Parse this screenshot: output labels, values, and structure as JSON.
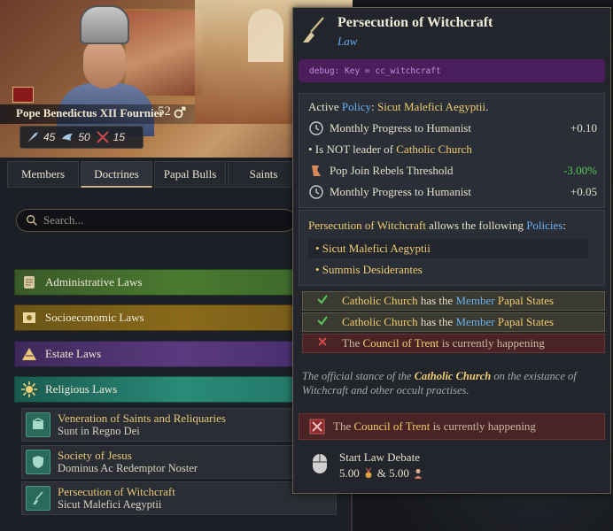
{
  "ruler": {
    "name": "Pope Benedictus XII Fournier",
    "age": "52",
    "stats": [
      "45",
      "50",
      "15"
    ]
  },
  "tabs": [
    "Members",
    "Doctrines",
    "Papal Bulls",
    "Saints"
  ],
  "search": {
    "placeholder": "Search..."
  },
  "categories": [
    "Administrative Laws",
    "Socioeconomic Laws",
    "Estate Laws",
    "Religious Laws"
  ],
  "laws": [
    {
      "title": "Veneration of Saints and Reliquaries",
      "sub": "Sunt in Regno Dei"
    },
    {
      "title": "Society of Jesus",
      "sub": "Dominus Ac Redemptor Noster"
    },
    {
      "title": "Persecution of Witchcraft",
      "sub": "Sicut Malefici Aegyptii"
    }
  ],
  "tooltip": {
    "title": "Persecution of Witchcraft",
    "type": "Law",
    "debug": "debug: Key = cc_witchcraft",
    "active_prefix": "Active ",
    "active_policy_word": "Policy",
    "active_colon": ": ",
    "active_policy": "Sicut Malefici Aegyptii",
    "active_period": ".",
    "effects": [
      {
        "label": "Monthly Progress to Humanist",
        "value": "+0.10"
      },
      {
        "label": "Pop Join Rebels Threshold",
        "value": "-3.00%"
      },
      {
        "label": "Monthly Progress to Humanist",
        "value": "+0.05"
      }
    ],
    "not_leader_prefix": "• Is NOT leader of ",
    "not_leader_entity": "Catholic Church",
    "allows_law": "Persecution of Witchcraft",
    "allows_mid": " allows the following ",
    "allows_word": "Policies",
    "allows_colon": ":",
    "policies": [
      "• Sicut Malefici Aegyptii",
      "• Summis Desiderantes"
    ],
    "triggers": [
      {
        "entity": "Catholic Church",
        "mid": " has the ",
        "role": "Member",
        "target": "Papal States"
      },
      {
        "entity": "Catholic Church",
        "mid": " has the ",
        "role": "Member",
        "target": "Papal States"
      }
    ],
    "trigger_bad_prefix": "The ",
    "trigger_bad_entity": "Council of Trent",
    "trigger_bad_suffix": " is currently happening",
    "desc_prefix": "The official stance of the ",
    "desc_entity": "Catholic Church",
    "desc_suffix": " on the existance of Witchcraft and other occult practises.",
    "block_prefix": "The ",
    "block_entity": "Council of Trent",
    "block_suffix": " is currently happening",
    "debate_label": "Start Law Debate",
    "debate_cost_1": "5.00",
    "debate_amp": "& 5.00"
  },
  "colors": {
    "accent_gold": "#f0cc70",
    "accent_blue": "#6ab0f0",
    "positive": "#5ac85a",
    "debug_purple": "#4a1e5a"
  }
}
